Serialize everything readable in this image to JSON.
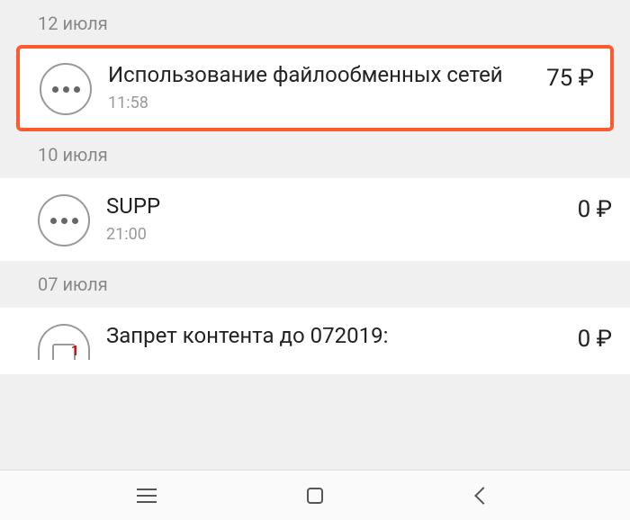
{
  "groups": [
    {
      "date": "12 июля",
      "items": [
        {
          "title": "Использование файлообменных сетей",
          "time": "11:58",
          "amount": "75 ₽",
          "highlighted": true,
          "avatar": "dots",
          "badge": null
        }
      ]
    },
    {
      "date": "10 июля",
      "items": [
        {
          "title": "SUPP",
          "time": "21:00",
          "amount": "0 ₽",
          "highlighted": false,
          "avatar": "dots",
          "badge": null
        }
      ]
    },
    {
      "date": "07 июля",
      "items": [
        {
          "title": "Запрет контента до 072019:",
          "time": "",
          "amount": "0 ₽",
          "highlighted": false,
          "avatar": "image",
          "badge": "1"
        }
      ]
    }
  ],
  "nav": {
    "menu": "menu",
    "home": "home",
    "back": "back"
  }
}
